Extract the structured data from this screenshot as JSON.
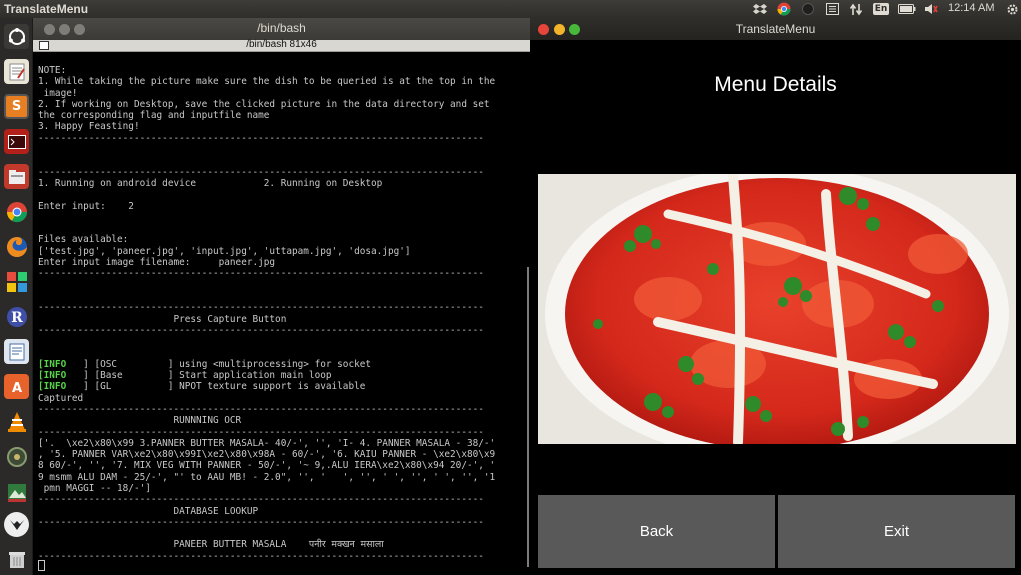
{
  "top_panel": {
    "app_name": "TranslateMenu",
    "keyboard_layout": "En",
    "clock": "12:14 AM",
    "icons": [
      "dropbox-icon",
      "chrome-icon",
      "tray-icon",
      "notes-icon",
      "network-icon",
      "keyboard-icon",
      "battery-icon",
      "volume-icon",
      "settings-icon"
    ]
  },
  "launcher": {
    "items": [
      "ubuntu-home-icon",
      "text-editor-icon",
      "sublime-text-icon",
      "terminal-icon",
      "file-manager-icon",
      "chrome-icon",
      "firefox-icon",
      "libreoffice-icon",
      "r-icon",
      "document-viewer-icon",
      "software-center-icon",
      "vlc-icon",
      "system-tool-icon",
      "image-tool-icon",
      "inkscape-icon",
      "trash-icon"
    ]
  },
  "terminal": {
    "window_title": "/bin/bash",
    "tab_title": "/bin/bash 81x46",
    "lines": [
      {
        "prefix": "",
        "text": "NOTE:"
      },
      {
        "prefix": "",
        "text": "1. While taking the picture make sure the dish to be queried is at the top in the"
      },
      {
        "prefix": "",
        "text": " image!"
      },
      {
        "prefix": "",
        "text": "2. If working on Desktop, save the clicked picture in the data directory and set"
      },
      {
        "prefix": "",
        "text": "the corresponding flag and inputfile name"
      },
      {
        "prefix": "",
        "text": "3. Happy Feasting!"
      },
      {
        "prefix": "",
        "text": "-------------------------------------------------------------------------------"
      },
      {
        "prefix": "",
        "text": ""
      },
      {
        "prefix": "",
        "text": ""
      },
      {
        "prefix": "",
        "text": "-------------------------------------------------------------------------------"
      },
      {
        "prefix": "",
        "text": "1. Running on android device            2. Running on Desktop"
      },
      {
        "prefix": "",
        "text": ""
      },
      {
        "prefix": "",
        "text": "Enter input:    2"
      },
      {
        "prefix": "",
        "text": ""
      },
      {
        "prefix": "",
        "text": ""
      },
      {
        "prefix": "",
        "text": "Files available:"
      },
      {
        "prefix": "",
        "text": "['test.jpg', 'paneer.jpg', 'input.jpg', 'uttapam.jpg', 'dosa.jpg']"
      },
      {
        "prefix": "",
        "text": "Enter input image filename:     paneer.jpg"
      },
      {
        "prefix": "",
        "text": "-------------------------------------------------------------------------------"
      },
      {
        "prefix": "",
        "text": ""
      },
      {
        "prefix": "",
        "text": ""
      },
      {
        "prefix": "",
        "text": "-------------------------------------------------------------------------------"
      },
      {
        "prefix": "",
        "text": "                        Press Capture Button"
      },
      {
        "prefix": "",
        "text": "-------------------------------------------------------------------------------"
      },
      {
        "prefix": "",
        "text": ""
      },
      {
        "prefix": "",
        "text": ""
      },
      {
        "prefix": "[INFO",
        "text": "   ] [OSC         ] using <multiprocessing> for socket"
      },
      {
        "prefix": "[INFO",
        "text": "   ] [Base        ] Start application main loop"
      },
      {
        "prefix": "[INFO",
        "text": "   ] [GL          ] NPOT texture support is available"
      },
      {
        "prefix": "",
        "text": "Captured"
      },
      {
        "prefix": "",
        "text": "-------------------------------------------------------------------------------"
      },
      {
        "prefix": "",
        "text": "                        RUNNNING OCR"
      },
      {
        "prefix": "",
        "text": "-------------------------------------------------------------------------------"
      },
      {
        "prefix": "",
        "text": "['.  \\xe2\\x80\\x99 3.PANNER BUTTER MASALA- 40/-', '', 'I- 4. PANNER MASALA - 38/-'"
      },
      {
        "prefix": "",
        "text": ", '5. PANNER VAR\\xe2\\x80\\x99I\\xe2\\x80\\x98A - 60/-', '6. KAIU PANNER - \\xe2\\x80\\x9"
      },
      {
        "prefix": "",
        "text": "8 60/-', '', '7. MIX VEG WITH PANNER - 50/-', '~ 9,.ALU IERA\\xe2\\x80\\x94 20/-', '"
      },
      {
        "prefix": "",
        "text": "9 msmm ALU DAM - 25/-', \"' to AAU MB! - 2.0\", '', '   ', '', ' ', '', ' ', '', '1"
      },
      {
        "prefix": "",
        "text": " pmn MAGGI -- 18/-']"
      },
      {
        "prefix": "",
        "text": "-------------------------------------------------------------------------------"
      },
      {
        "prefix": "",
        "text": "                        DATABASE LOOKUP"
      },
      {
        "prefix": "",
        "text": "-------------------------------------------------------------------------------"
      },
      {
        "prefix": "",
        "text": ""
      },
      {
        "prefix": "",
        "text": "                        PANEER BUTTER MASALA    पनीर मक्खन मसाला"
      },
      {
        "prefix": "",
        "text": "-------------------------------------------------------------------------------"
      }
    ]
  },
  "app": {
    "window_title": "TranslateMenu",
    "heading": "Menu Details",
    "buttons": {
      "back": "Back",
      "exit": "Exit"
    }
  },
  "colors": {
    "terminal_bg": "#000000",
    "terminal_text": "#c8c8c8",
    "info_green": "#58d34a",
    "button_gray": "#595959",
    "curry_red": "#d4281b"
  }
}
